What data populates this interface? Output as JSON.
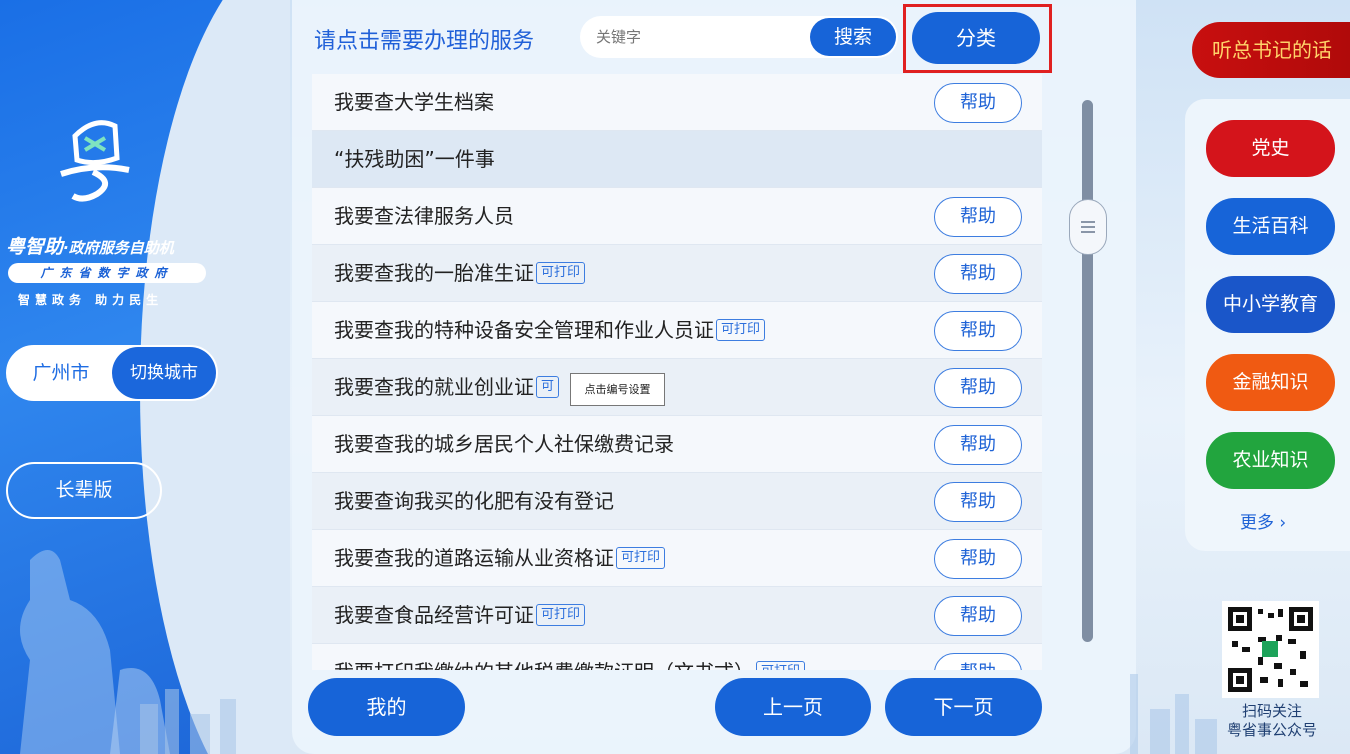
{
  "sidebar": {
    "brand_name": "粤智助",
    "brand_sub": "·政府服务自助机",
    "org": "广东省数字政府",
    "slogan": "智慧政务 助力民生",
    "city": "广州市",
    "switch_city": "切换城市",
    "elder_mode": "长辈版"
  },
  "header": {
    "title": "请点击需要办理的服务",
    "search_placeholder": "关键字",
    "search_button": "搜索",
    "category_button": "分类"
  },
  "services": [
    {
      "name": "我要查大学生档案",
      "tag": "",
      "help": "帮助"
    },
    {
      "name": "“扶残助困”一件事",
      "tag": "",
      "help": ""
    },
    {
      "name": "我要查法律服务人员",
      "tag": "",
      "help": "帮助"
    },
    {
      "name": "我要查我的一胎准生证",
      "tag": "可打印",
      "help": "帮助"
    },
    {
      "name": "我要查我的特种设备安全管理和作业人员证",
      "tag": "可打印",
      "help": "帮助"
    },
    {
      "name": "我要查我的就业创业证",
      "tag": "可",
      "help": "帮助"
    },
    {
      "name": "我要查我的城乡居民个人社保缴费记录",
      "tag": "",
      "help": "帮助"
    },
    {
      "name": "我要查询我买的化肥有没有登记",
      "tag": "",
      "help": "帮助"
    },
    {
      "name": "我要查我的道路运输从业资格证",
      "tag": "可打印",
      "help": "帮助"
    },
    {
      "name": "我要查食品经营许可证",
      "tag": "可打印",
      "help": "帮助"
    },
    {
      "name": "我要打印我缴纳的其他税费缴款证明（文书式）",
      "tag": "可打印",
      "help": "帮助"
    }
  ],
  "tooltip": "点击编号设置",
  "footer": {
    "mine": "我的",
    "prev": "上一页",
    "next": "下一页"
  },
  "right": {
    "talk": "听总书记的话",
    "items": [
      {
        "label": "党史",
        "color": "#d4141b"
      },
      {
        "label": "生活百科",
        "color": "#1764d8"
      },
      {
        "label": "中小学教育",
        "color": "#1a56c9"
      },
      {
        "label": "金融知识",
        "color": "#f05a12"
      },
      {
        "label": "农业知识",
        "color": "#22a53e"
      }
    ],
    "more": "更多 ›",
    "qr_caption_1": "扫码关注",
    "qr_caption_2": "粤省事公众号"
  }
}
